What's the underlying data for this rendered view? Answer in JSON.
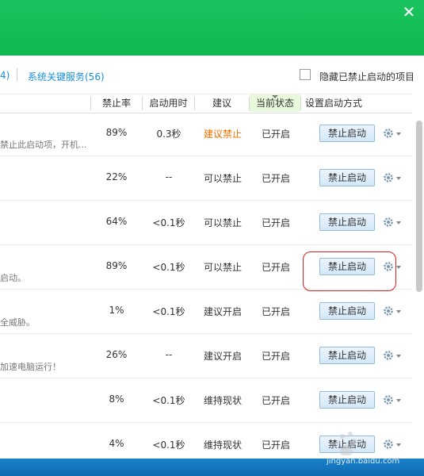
{
  "header": {
    "close_glyph": "✕",
    "close_icon": "close-icon"
  },
  "tabs": {
    "partial_label": "4)",
    "services_label": "系统关键服务(56)"
  },
  "hide_disabled": {
    "label": "隐藏已禁止启动的项目",
    "checked": false
  },
  "columns": {
    "rate": "禁止率",
    "time": "启动用时",
    "advice": "建议",
    "state": "当前状态",
    "method": "设置启动方式"
  },
  "rows": [
    {
      "desc": "禁止此启动项，开机...",
      "rate": "89%",
      "time": "0.3秒",
      "advice": "建议禁止",
      "state": "已开启",
      "button": "禁止启动"
    },
    {
      "desc": "",
      "rate": "22%",
      "time": "--",
      "advice": "可以禁止",
      "state": "已开启",
      "button": "禁止启动"
    },
    {
      "desc": "",
      "rate": "64%",
      "time": "<0.1秒",
      "advice": "可以禁止",
      "state": "已开启",
      "button": "禁止启动"
    },
    {
      "desc": "启动。",
      "rate": "89%",
      "time": "<0.1秒",
      "advice": "可以禁止",
      "state": "已开启",
      "button": "禁止启动"
    },
    {
      "desc": "全威胁。",
      "rate": "1%",
      "time": "<0.1秒",
      "advice": "建议开启",
      "state": "已开启",
      "button": "禁止启动"
    },
    {
      "desc": "加速电脑运行！",
      "rate": "26%",
      "time": "--",
      "advice": "建议开启",
      "state": "已开启",
      "button": "禁止启动"
    },
    {
      "desc": "",
      "rate": "8%",
      "time": "<0.1秒",
      "advice": "维持现状",
      "state": "已开启",
      "button": "禁止启动"
    },
    {
      "desc": "",
      "rate": "4%",
      "time": "<0.1秒",
      "advice": "维持现状",
      "state": "已开启",
      "button": "禁止启动"
    }
  ],
  "watermark": {
    "text": "Bai 经验",
    "url": "jingyan.baidu.com"
  },
  "colors": {
    "header_green": "#19c35e",
    "link_blue": "#1a8fd8",
    "warn_orange": "#f07000",
    "highlight_red": "#e02020",
    "state_bg": "#e9f9dc"
  }
}
